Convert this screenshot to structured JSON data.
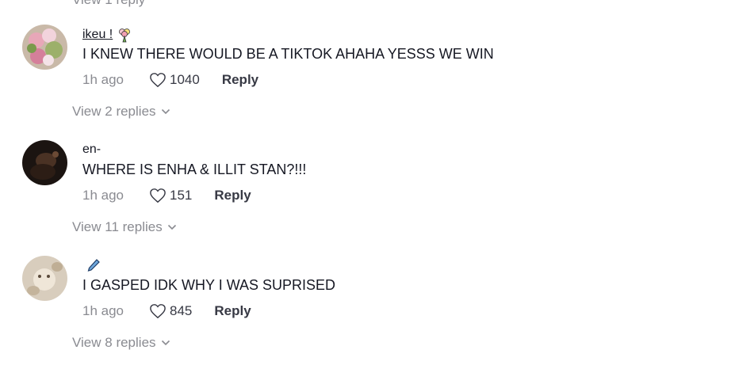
{
  "top_clip": "View 1 reply",
  "comments": [
    {
      "author": "ikeu !",
      "author_badge": "rose-bouquet-icon",
      "text": "I KNEW THERE WOULD BE A TIKTOK AHAHA YESSS WE WIN",
      "time": "1h ago",
      "likes": "1040",
      "reply_label": "Reply",
      "view_replies": "View 2 replies"
    },
    {
      "author": "en-",
      "text": "WHERE IS ENHA & ILLIT STAN?!!!",
      "time": "1h ago",
      "likes": "151",
      "reply_label": "Reply",
      "view_replies": "View 11 replies"
    },
    {
      "author": "",
      "author_badge": "pen-icon",
      "text": "I GASPED IDK WHY I WAS SUPRISED",
      "time": "1h ago",
      "likes": "845",
      "reply_label": "Reply",
      "view_replies": "View 8 replies"
    }
  ],
  "colors": {
    "text": "#161823",
    "muted": "#8a8b91",
    "action": "#373944"
  }
}
